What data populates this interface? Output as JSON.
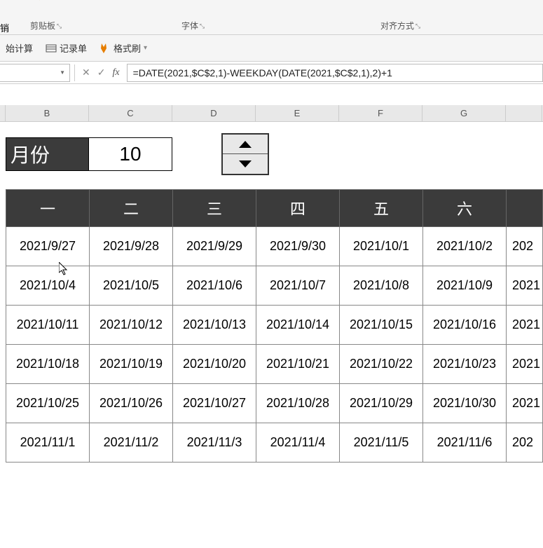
{
  "ribbon": {
    "undo_label": "销",
    "clipboard_label": "剪贴板",
    "font_label": "字体",
    "align_label": "对齐方式"
  },
  "secondary": {
    "calc_label": "始计算",
    "record_label": "记录单",
    "format_label": "格式刷"
  },
  "formula_bar": {
    "formula": "=DATE(2021,$C$2,1)-WEEKDAY(DATE(2021,$C$2,1),2)+1"
  },
  "columns": [
    "B",
    "C",
    "D",
    "E",
    "F",
    "G"
  ],
  "month_section": {
    "label": "月份",
    "value": "10"
  },
  "calendar": {
    "headers": [
      "一",
      "二",
      "三",
      "四",
      "五",
      "六",
      ""
    ],
    "rows": [
      [
        "2021/9/27",
        "2021/9/28",
        "2021/9/29",
        "2021/9/30",
        "2021/10/1",
        "2021/10/2",
        "202"
      ],
      [
        "2021/10/4",
        "2021/10/5",
        "2021/10/6",
        "2021/10/7",
        "2021/10/8",
        "2021/10/9",
        "2021"
      ],
      [
        "2021/10/11",
        "2021/10/12",
        "2021/10/13",
        "2021/10/14",
        "2021/10/15",
        "2021/10/16",
        "2021"
      ],
      [
        "2021/10/18",
        "2021/10/19",
        "2021/10/20",
        "2021/10/21",
        "2021/10/22",
        "2021/10/23",
        "2021"
      ],
      [
        "2021/10/25",
        "2021/10/26",
        "2021/10/27",
        "2021/10/28",
        "2021/10/29",
        "2021/10/30",
        "2021"
      ],
      [
        "2021/11/1",
        "2021/11/2",
        "2021/11/3",
        "2021/11/4",
        "2021/11/5",
        "2021/11/6",
        "202"
      ]
    ]
  }
}
